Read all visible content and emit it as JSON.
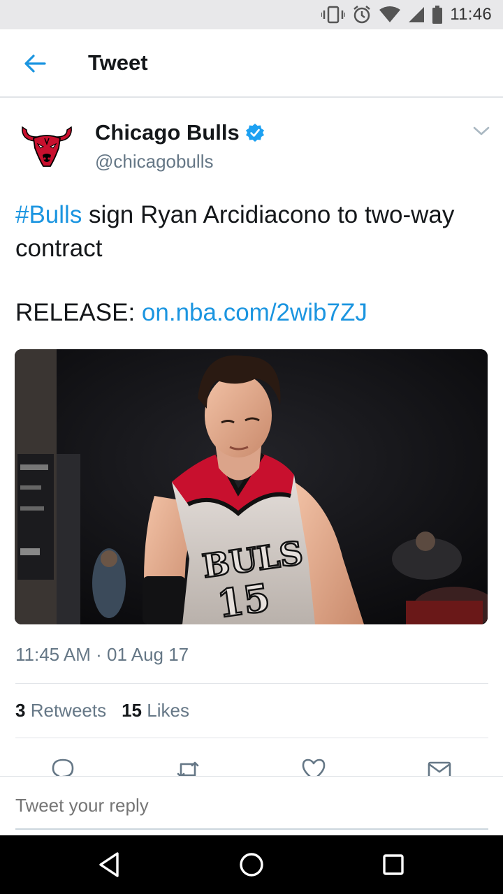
{
  "status_bar": {
    "time": "11:46"
  },
  "app_bar": {
    "title": "Tweet"
  },
  "tweet": {
    "author_name": "Chicago Bulls",
    "author_handle": "@chicagobulls",
    "text_hashtag": "#Bulls",
    "text_body": " sign Ryan Arcidiacono to two-way contract",
    "release_label": "RELEASE: ",
    "release_link": "on.nba.com/2wib7ZJ",
    "timestamp": "11:45 AM · 01 Aug 17",
    "retweets_count": "3",
    "retweets_label": "Retweets",
    "likes_count": "15",
    "likes_label": "Likes"
  },
  "reply": {
    "placeholder": "Tweet your reply"
  },
  "colors": {
    "accent": "#1b95e0",
    "verified": "#1da1f2",
    "muted": "#657786",
    "jersey_red": "#c8102e"
  },
  "icons": {
    "back": "arrow-left-icon",
    "verified": "verified-badge-icon",
    "caret": "chevron-down-icon",
    "reply": "reply-icon",
    "retweet": "retweet-icon",
    "like": "heart-icon",
    "message": "envelope-icon",
    "nav_back": "triangle-back-icon",
    "nav_home": "circle-home-icon",
    "nav_recents": "square-recents-icon"
  }
}
